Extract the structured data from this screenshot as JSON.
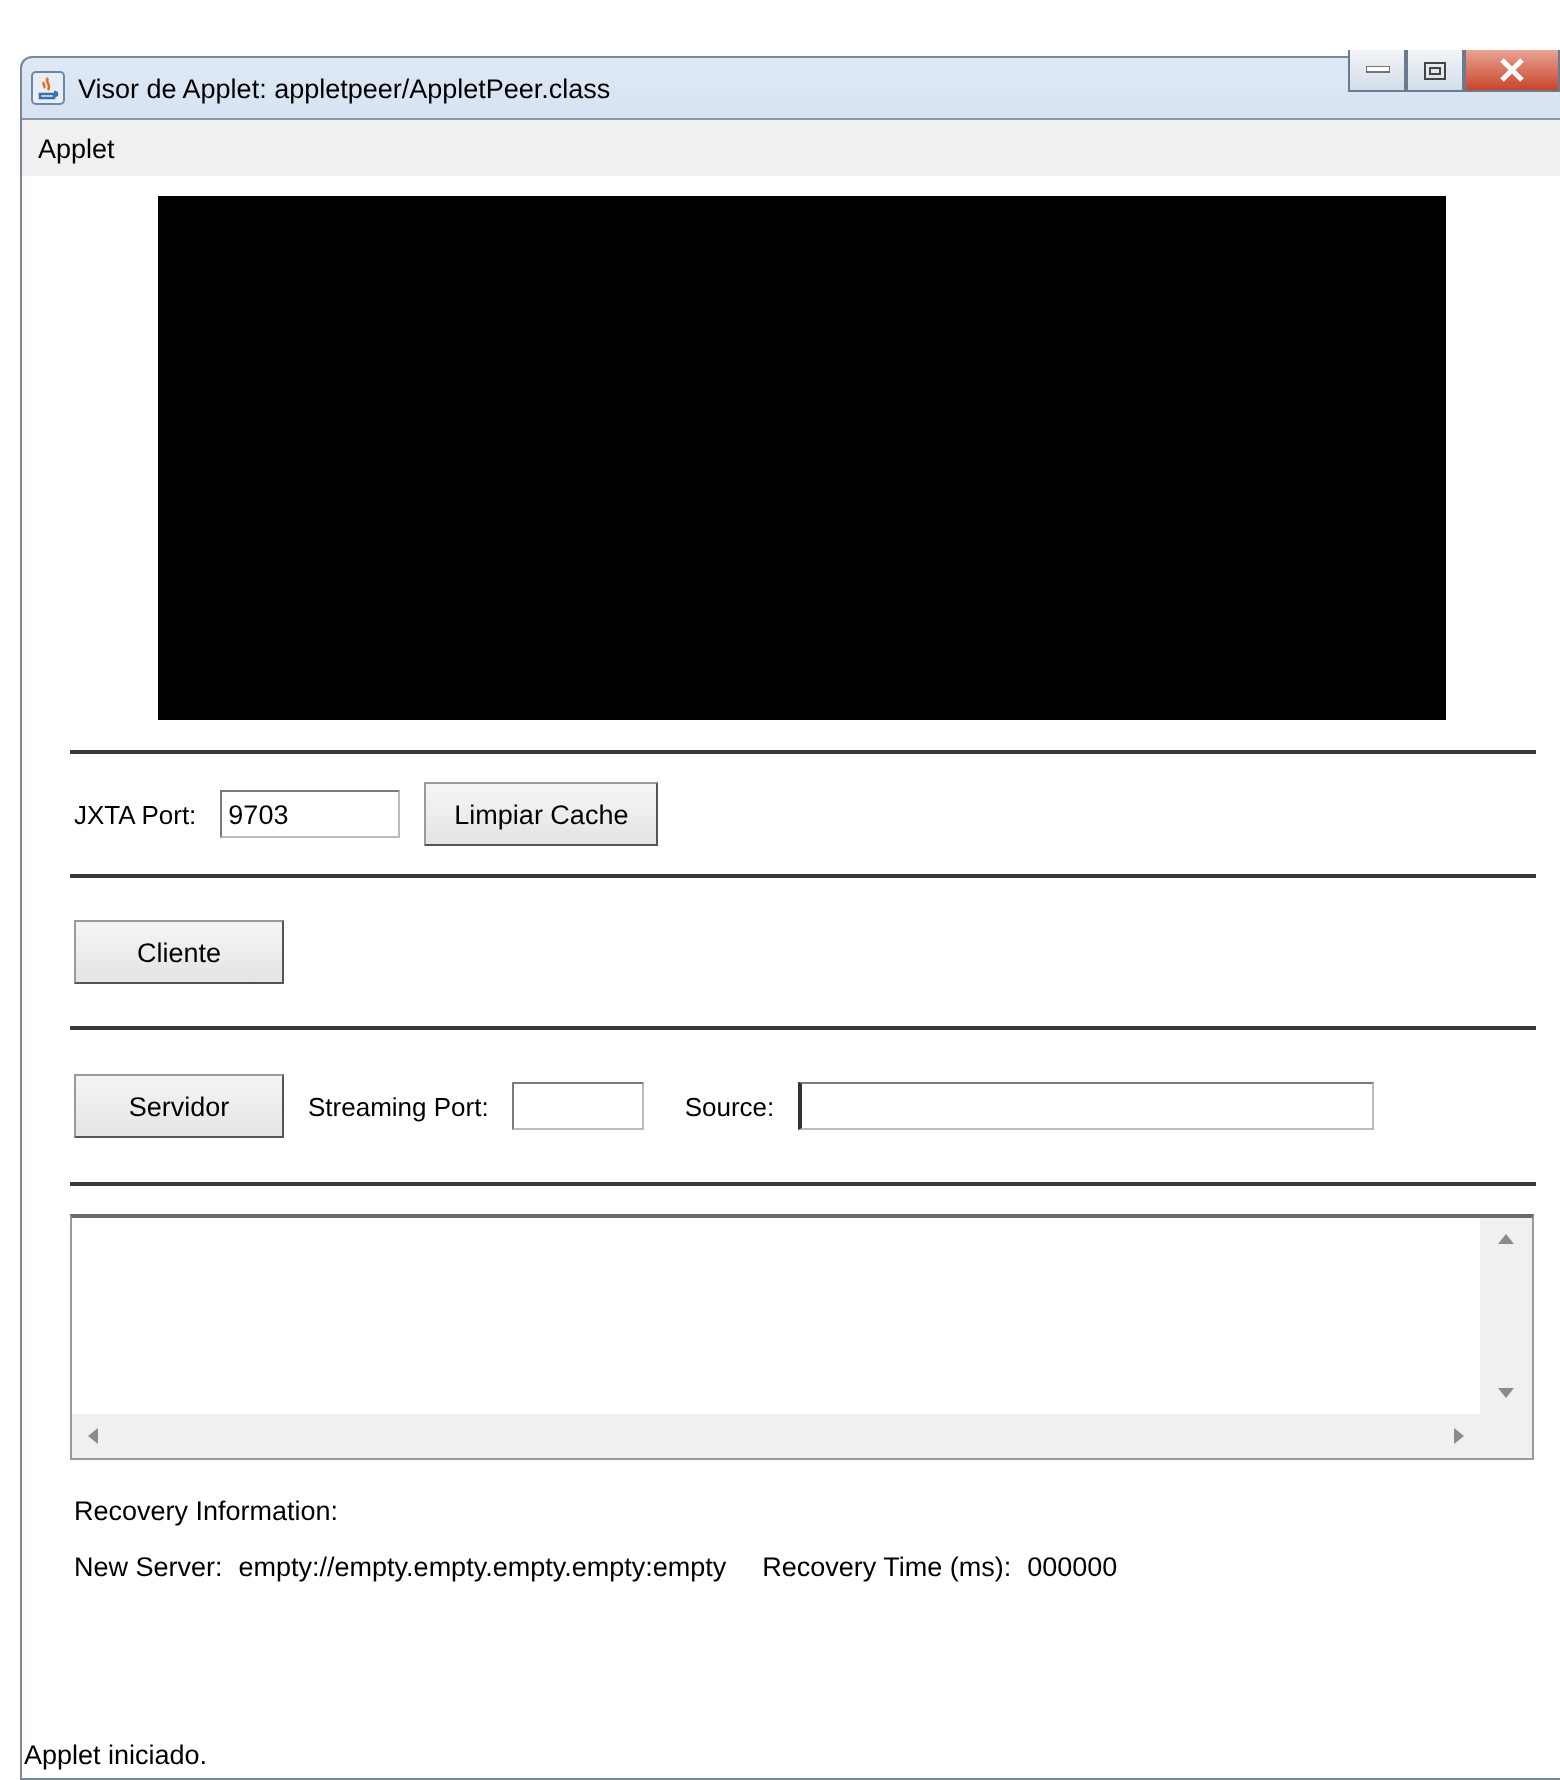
{
  "window": {
    "title": "Visor de Applet: appletpeer/AppletPeer.class"
  },
  "menu": [
    "Applet"
  ],
  "jxta_row": {
    "label": "JXTA Port:",
    "value": "9703",
    "button": "Limpiar Cache"
  },
  "client_row": {
    "button": "Cliente"
  },
  "server_row": {
    "button": "Servidor",
    "port_label": "Streaming Port:",
    "source_label": "Source:",
    "source_focused": true
  },
  "recovery": {
    "title": "Recovery Information:",
    "server_label": "New Server:",
    "server_value": "empty://empty.empty.empty.empty:empty",
    "time_label": "Recovery Time (ms):",
    "time_value": "000000"
  },
  "status_bar": "Applet iniciado."
}
